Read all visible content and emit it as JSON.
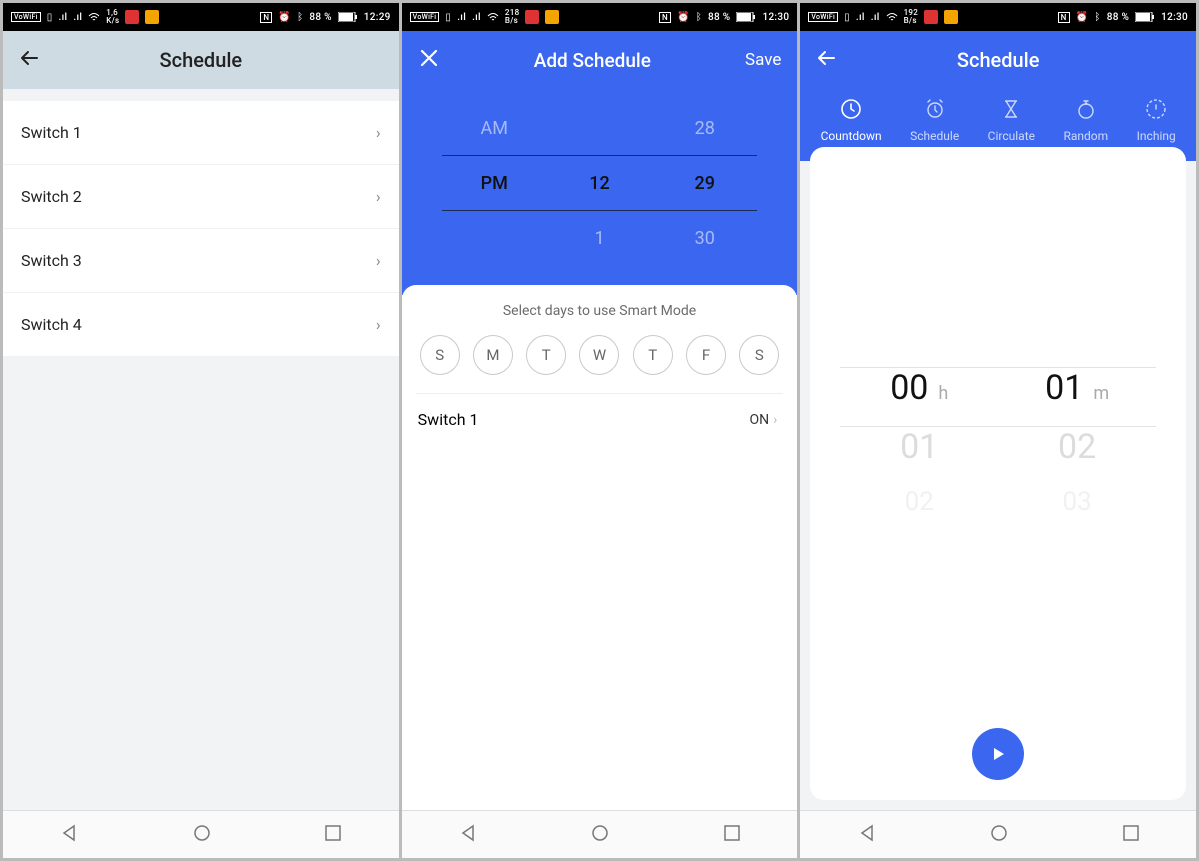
{
  "screen1": {
    "status": {
      "rate_top": "1,6",
      "rate_bot": "K/s",
      "batt": "88 %",
      "time": "12:29"
    },
    "title": "Schedule",
    "items": [
      {
        "label": "Switch 1"
      },
      {
        "label": "Switch 2"
      },
      {
        "label": "Switch 3"
      },
      {
        "label": "Switch 4"
      }
    ]
  },
  "screen2": {
    "status": {
      "rate_top": "218",
      "rate_bot": "B/s",
      "batt": "88 %",
      "time": "12:30"
    },
    "title": "Add Schedule",
    "save": "Save",
    "picker": {
      "col1": [
        "AM",
        "PM",
        ""
      ],
      "col2": [
        "",
        "12",
        "1"
      ],
      "col3": [
        "28",
        "29",
        "30"
      ]
    },
    "smart_label": "Select days to use Smart Mode",
    "days": [
      "S",
      "M",
      "T",
      "W",
      "T",
      "F",
      "S"
    ],
    "switch": {
      "name": "Switch 1",
      "state": "ON"
    }
  },
  "screen3": {
    "status": {
      "rate_top": "192",
      "rate_bot": "B/s",
      "batt": "88 %",
      "time": "12:30"
    },
    "title": "Schedule",
    "tabs": [
      {
        "label": "Countdown"
      },
      {
        "label": "Schedule"
      },
      {
        "label": "Circulate"
      },
      {
        "label": "Random"
      },
      {
        "label": "Inching"
      }
    ],
    "time": {
      "h_sel": "00",
      "m_sel": "01",
      "h_next": "01",
      "m_next": "02",
      "h_next2": "02",
      "m_next2": "03",
      "h_unit": "h",
      "m_unit": "m"
    }
  }
}
